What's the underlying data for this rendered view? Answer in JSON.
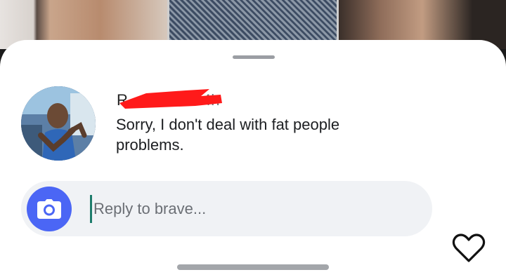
{
  "background": {
    "photos": [
      "photo-1",
      "photo-2",
      "photo-3"
    ]
  },
  "comment": {
    "username": "R",
    "timestamp": "4h",
    "text": "Sorry, I don't deal with fat people problems.",
    "redaction_color": "#ff1a1a"
  },
  "reply": {
    "placeholder": "Reply to brave...",
    "camera_icon": "camera-icon",
    "accent_color": "#4b66f5"
  },
  "actions": {
    "like_icon": "heart-outline-icon"
  }
}
